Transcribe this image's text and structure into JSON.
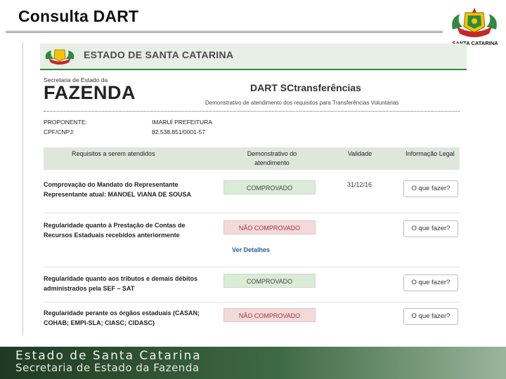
{
  "slide": {
    "title": "Consulta DART",
    "logo_caption": "SANTA CATARINA"
  },
  "page": {
    "banner_text": "ESTADO DE SANTA CATARINA",
    "secretaria": "Secretaria de Estado da",
    "fazenda": "FAZENDA",
    "dart_title": "DART SCtransferências",
    "dart_subtitle": "Demonstrativo de atendimento dos requisitos para Transferências Voluntárias",
    "proponente_label": "PROPONENTE:",
    "proponente_value": "IMARUÍ PREFEITURA",
    "cnpj_label": "CPF/CNPJ:",
    "cnpj_value": "82.538.851/0001-57"
  },
  "table": {
    "headers": {
      "requisitos": "Requisitos a serem atendidos",
      "demonstrativo": "Demonstrativo do atendimento",
      "validade": "Validade",
      "informacao": "Informação Legal"
    },
    "rows": [
      {
        "requirement": "Comprovação do Mandato do Representante Representante atual: MANOEL VIANA DE SOUSA",
        "status": "COMPROVADO",
        "validade": "31/12/16",
        "action": "O que fazer?"
      },
      {
        "requirement": "Regularidade quanto à Prestação de Contas de Recursos Estaduais recebidos anteriormente",
        "status": "NÃO COMPROVADO",
        "validade": "",
        "action": "O que fazer?"
      },
      {
        "requirement": "Regularidade quanto aos tributos e demais débitos administrados pela SEF – SAT",
        "status": "COMPROVADO",
        "validade": "",
        "action": "O que fazer?"
      },
      {
        "requirement": "Regularidade perante os órgãos estaduais (CASAN; COHAB; EMPI-SLA; CIASC; CIDASC)",
        "status": "NÃO COMPROVADO",
        "validade": "",
        "action": "O que fazer?"
      }
    ],
    "ver_detalhes": "Ver Detalhes"
  },
  "footer": {
    "line1": "Estado de Santa Catarina",
    "line2": "Secretaria de Estado da Fazenda"
  },
  "colors": {
    "ok_bg": "#d9ecd6",
    "nok_bg": "#f3dada",
    "banner_green": "#2e8b3e",
    "footer_dark": "#1f3a22"
  }
}
